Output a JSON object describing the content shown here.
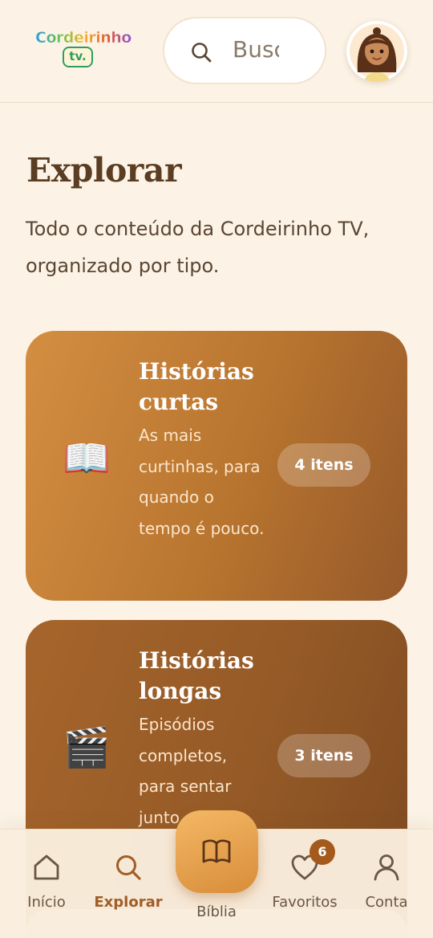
{
  "header": {
    "logo_top": "Cordeirinho",
    "logo_bottom": "tv.",
    "search_placeholder": "Buscar"
  },
  "main": {
    "title": "Explorar",
    "subtitle": "Todo o conteúdo da Cordeirinho TV, organizado por tipo."
  },
  "cards": [
    {
      "emoji": "📖",
      "title": "Histórias curtas",
      "description": "As mais curtinhas, para quando o tempo é pouco.",
      "count": "4 itens"
    },
    {
      "emoji": "🎬",
      "title": "Histórias longas",
      "description": "Episódios completos, para sentar junto",
      "count": "3 itens"
    }
  ],
  "nav": {
    "items": [
      {
        "label": "Início",
        "icon": "home-icon"
      },
      {
        "label": "Explorar",
        "icon": "search-icon"
      },
      {
        "label": "Bíblia",
        "icon": "book-icon"
      },
      {
        "label": "Favoritos",
        "icon": "heart-icon"
      },
      {
        "label": "Conta",
        "icon": "user-icon"
      }
    ],
    "favorites_count": "6",
    "active": "Explorar"
  },
  "colors": {
    "background": "#fcf3e6",
    "accent": "#a05d27",
    "card1": "#c4803a",
    "card2": "#8f5525"
  }
}
